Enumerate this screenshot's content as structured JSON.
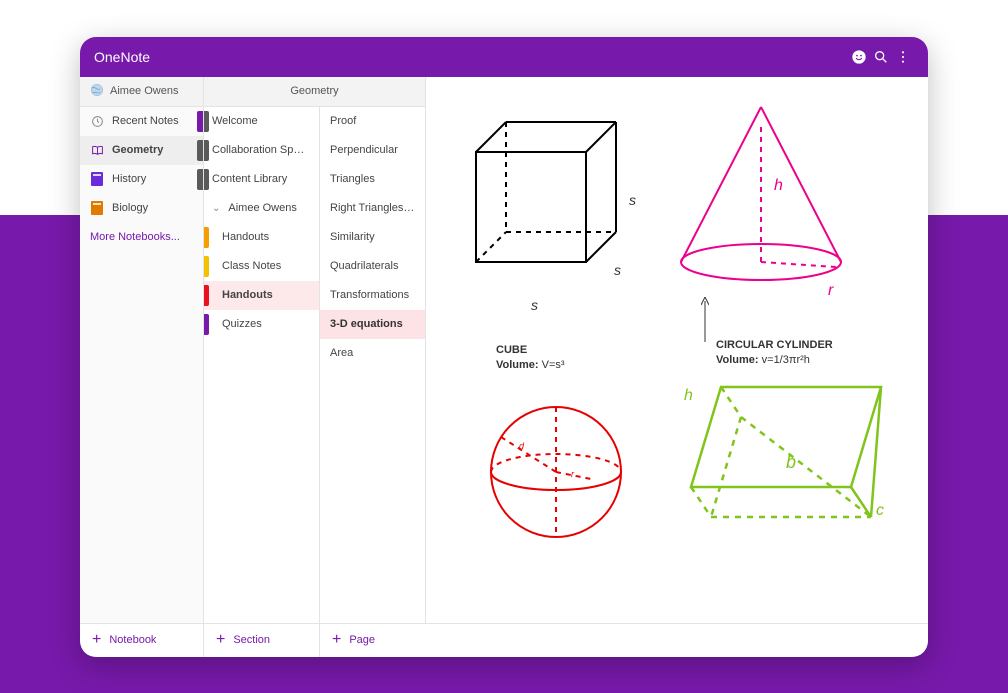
{
  "app_title": "OneNote",
  "colors": {
    "brand": "#7719AA",
    "tab_purple": "#7719AA",
    "tab_gray": "#5a5a5a",
    "tab_teal": "#2a8b8b",
    "tab_orange_dark": "#e07b00",
    "tab_orange": "#f59e00",
    "tab_yellow": "#f2c200",
    "tab_red": "#e81123"
  },
  "notebook_header": {
    "label": "Aimee Owens"
  },
  "notebooks": [
    {
      "icon": "clock-icon",
      "label": "Recent Notes",
      "tab_color": "#7719AA"
    },
    {
      "icon": "book-open-icon",
      "label": "Geometry",
      "tab_color": "#5a5a5a",
      "selected": true
    },
    {
      "icon": "book-icon",
      "label": "History",
      "tab_color": "#5a5a5a",
      "book_color": "#6a2bd9"
    },
    {
      "icon": "book-icon",
      "label": "Biology",
      "tab_color": null,
      "book_color": "#e07b00"
    }
  ],
  "more_notebooks_label": "More Notebooks...",
  "section_group_header": "Geometry",
  "sections": [
    {
      "label": "Welcome",
      "tab_color": "#5a5a5a"
    },
    {
      "label": "Collaboration Sp…",
      "tab_color": "#5a5a5a"
    },
    {
      "label": "Content Library",
      "tab_color": "#5a5a5a"
    },
    {
      "label": "Aimee Owens",
      "expandable": true
    },
    {
      "label": "Handouts",
      "sub": true,
      "tab_color": "#f59e00"
    },
    {
      "label": "Class Notes",
      "sub": true,
      "tab_color": "#f2c200"
    },
    {
      "label": "Handouts",
      "sub": true,
      "tab_color": "#e81123",
      "selected": true
    },
    {
      "label": "Quizzes",
      "sub": true,
      "tab_color": "#7719AA"
    }
  ],
  "pages": [
    {
      "label": "Proof"
    },
    {
      "label": "Perpendicular"
    },
    {
      "label": "Triangles"
    },
    {
      "label": "Right Triangles…"
    },
    {
      "label": "Similarity"
    },
    {
      "label": "Quadrilaterals"
    },
    {
      "label": "Transformations"
    },
    {
      "label": "3-D equations",
      "selected": true
    },
    {
      "label": "Area"
    }
  ],
  "footer": {
    "notebook": "Notebook",
    "section": "Section",
    "page": "Page"
  },
  "content": {
    "cube": {
      "title": "CUBE",
      "volume_label": "Volume:",
      "volume_value": "V=s³",
      "side_label": "s"
    },
    "cone": {
      "title": "CIRCULAR CYLINDER",
      "volume_label": "Volume:",
      "volume_value": "v=1/3πr²h",
      "h_label": "h",
      "r_label": "r"
    },
    "sphere": {
      "d_label": "d",
      "r_label": "r"
    },
    "prism": {
      "h_label": "h",
      "b_label": "b",
      "c_label": "c"
    }
  }
}
